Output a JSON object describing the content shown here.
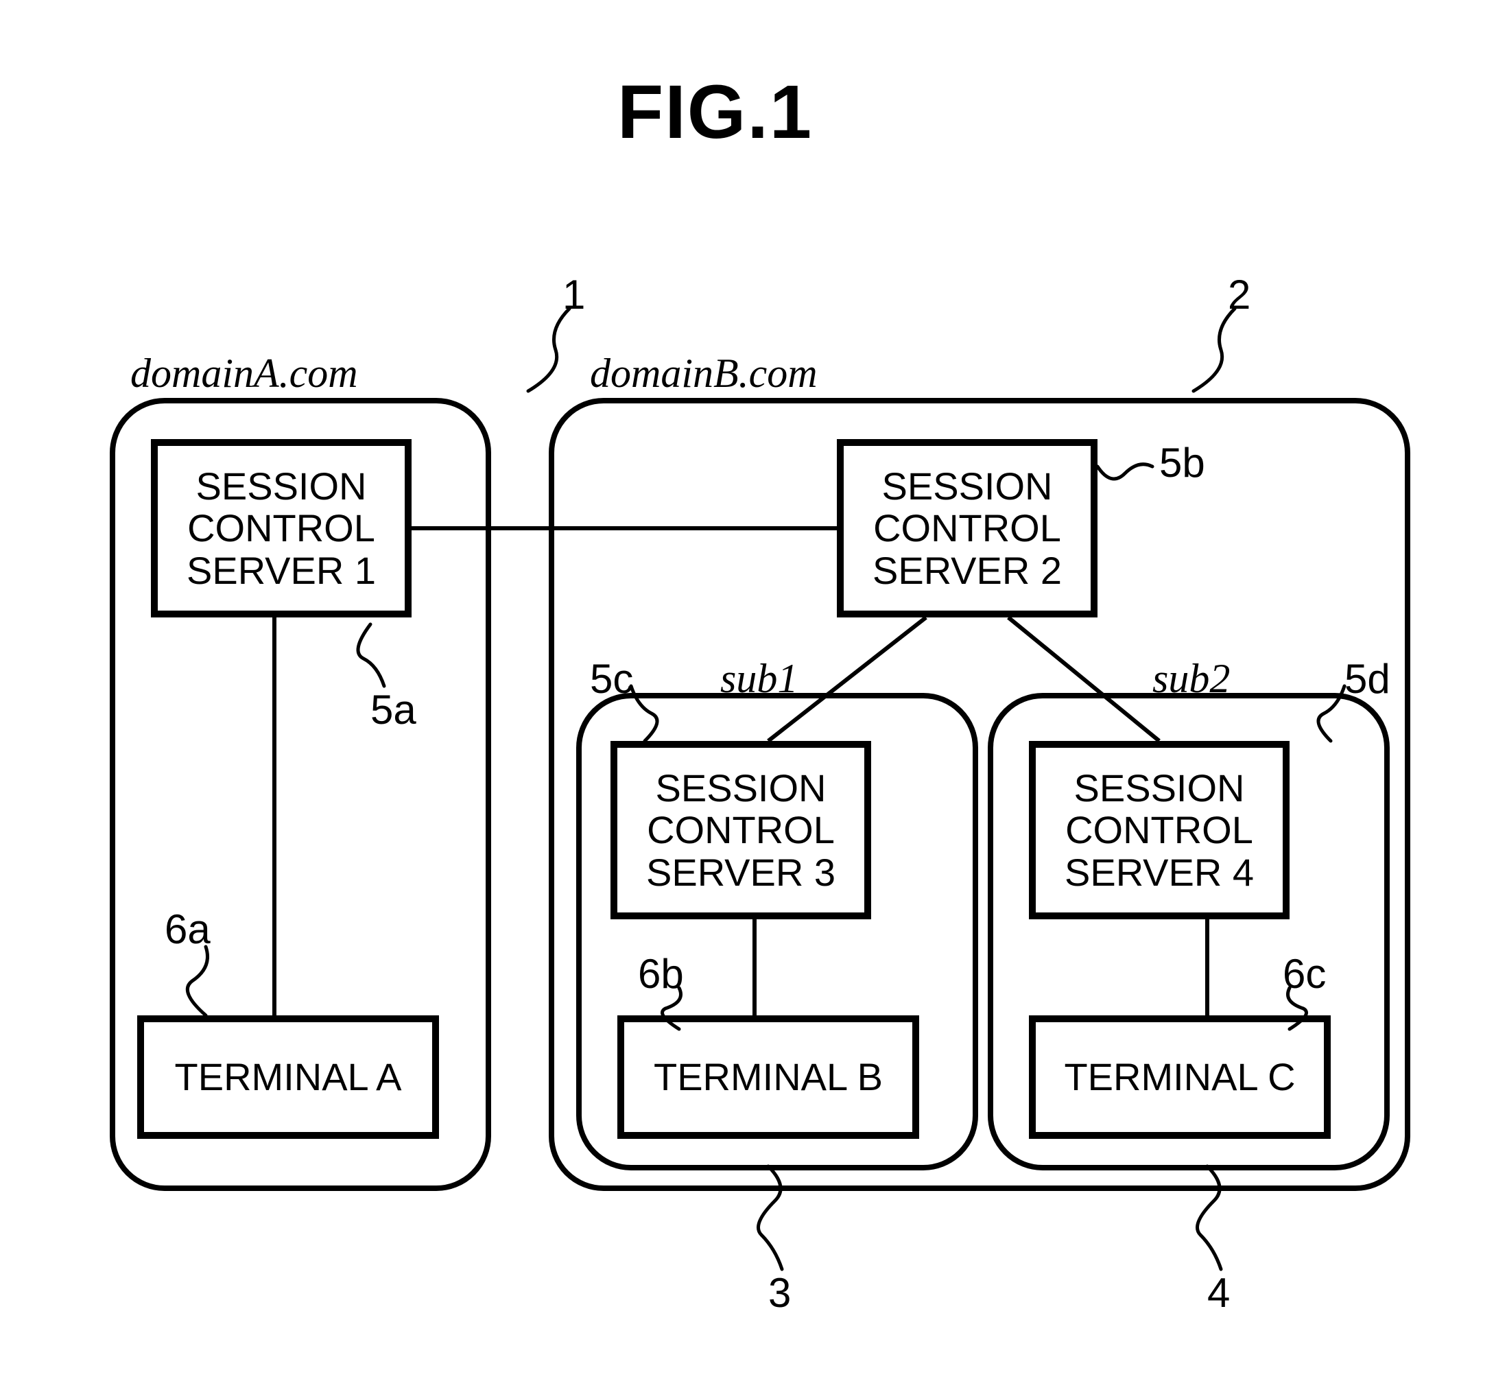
{
  "figure_title": "FIG.1",
  "domains": {
    "A": {
      "label": "domainA.com",
      "ref": "1"
    },
    "B": {
      "label": "domainB.com",
      "ref": "2"
    }
  },
  "subdomains": {
    "S1": {
      "label": "sub1",
      "ref": "3"
    },
    "S2": {
      "label": "sub2",
      "ref": "4"
    }
  },
  "nodes": {
    "scs1": {
      "line1": "SESSION",
      "line2": "CONTROL",
      "line3": "SERVER 1",
      "ref": "5a"
    },
    "scs2": {
      "line1": "SESSION",
      "line2": "CONTROL",
      "line3": "SERVER 2",
      "ref": "5b"
    },
    "scs3": {
      "line1": "SESSION",
      "line2": "CONTROL",
      "line3": "SERVER 3",
      "ref": "5c"
    },
    "scs4": {
      "line1": "SESSION",
      "line2": "CONTROL",
      "line3": "SERVER 4",
      "ref": "5d"
    },
    "termA": {
      "label": "TERMINAL A",
      "ref": "6a"
    },
    "termB": {
      "label": "TERMINAL B",
      "ref": "6b"
    },
    "termC": {
      "label": "TERMINAL C",
      "ref": "6c"
    }
  }
}
